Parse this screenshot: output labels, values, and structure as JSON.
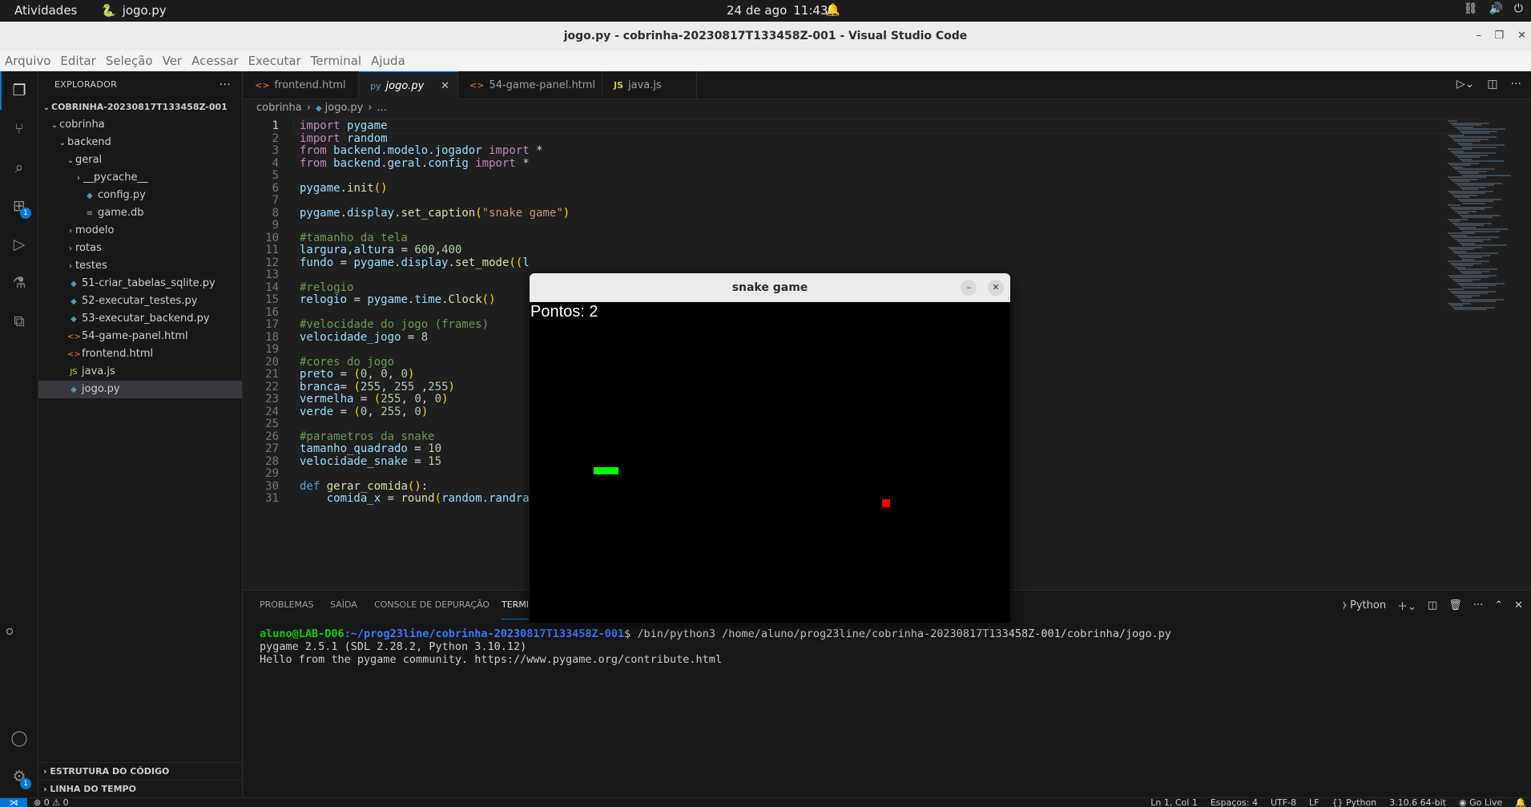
{
  "topbar": {
    "activities": "Atividades",
    "app_name": "jogo.py",
    "date": "24 de ago",
    "time": "11:43"
  },
  "window": {
    "title": "jogo.py - cobrinha-20230817T133458Z-001 - Visual Studio Code"
  },
  "menu": [
    "Arquivo",
    "Editar",
    "Seleção",
    "Ver",
    "Acessar",
    "Executar",
    "Terminal",
    "Ajuda"
  ],
  "activitybar": {
    "extensions_badge": "1",
    "settings_badge": "1"
  },
  "sidebar": {
    "title": "EXPLORADOR",
    "root": "COBRINHA-20230817T133458Z-001",
    "tree": [
      {
        "label": "cobrinha",
        "depth": 0,
        "kind": "folder-open"
      },
      {
        "label": "backend",
        "depth": 1,
        "kind": "folder-open"
      },
      {
        "label": "geral",
        "depth": 2,
        "kind": "folder-open"
      },
      {
        "label": "__pycache__",
        "depth": 3,
        "kind": "folder"
      },
      {
        "label": "config.py",
        "depth": 3,
        "kind": "py"
      },
      {
        "label": "game.db",
        "depth": 3,
        "kind": "db"
      },
      {
        "label": "modelo",
        "depth": 2,
        "kind": "folder"
      },
      {
        "label": "rotas",
        "depth": 2,
        "kind": "folder"
      },
      {
        "label": "testes",
        "depth": 2,
        "kind": "folder"
      },
      {
        "label": "51-criar_tabelas_sqlite.py",
        "depth": 1,
        "kind": "py"
      },
      {
        "label": "52-executar_testes.py",
        "depth": 1,
        "kind": "py"
      },
      {
        "label": "53-executar_backend.py",
        "depth": 1,
        "kind": "py"
      },
      {
        "label": "54-game-panel.html",
        "depth": 1,
        "kind": "html"
      },
      {
        "label": "frontend.html",
        "depth": 1,
        "kind": "html"
      },
      {
        "label": "java.js",
        "depth": 1,
        "kind": "js"
      },
      {
        "label": "jogo.py",
        "depth": 1,
        "kind": "py",
        "selected": true
      }
    ],
    "outline": "ESTRUTURA DO CÓDIGO",
    "timeline": "LINHA DO TEMPO"
  },
  "tabs": [
    {
      "label": "frontend.html",
      "icon": "<>"
    },
    {
      "label": "jogo.py",
      "icon": "py",
      "active": true
    },
    {
      "label": "54-game-panel.html",
      "icon": "<>"
    },
    {
      "label": "java.js",
      "icon": "JS"
    }
  ],
  "breadcrumb": {
    "folder": "cobrinha",
    "file": "jogo.py",
    "symbol": "..."
  },
  "code": [
    "import pygame",
    "import random",
    "from backend.modelo.jogador import *",
    "from backend.geral.config import *",
    "",
    "pygame.init()",
    "",
    "pygame.display.set_caption(\"snake game\")",
    "",
    "#tamanho da tela",
    "largura,altura = 600,400",
    "fundo = pygame.display.set_mode((l",
    "",
    "#relogio",
    "relogio = pygame.time.Clock()",
    "",
    "#velocidade do jogo (frames)",
    "velocidade_jogo = 8",
    "",
    "#cores do jogo",
    "preto = (0, 0, 0)",
    "branca= (255, 255 ,255)",
    "vermelha = (255, 0, 0)",
    "verde = (0, 255, 0)",
    "",
    "#parametros da snake",
    "tamanho_quadrado = 10",
    "velocidade_snake = 15",
    "",
    "def gerar_comida():",
    "    comida_x = round(random.randra"
  ],
  "panel": {
    "tabs": [
      "PROBLEMAS",
      "SAÍDA",
      "CONSOLE DE DEPURAÇÃO",
      "TERMI"
    ],
    "terminal_profile": "Python",
    "prompt_user": "aluno@LAB-D06",
    "prompt_path": ":~/prog23line/cobrinha-20230817T133458Z-001",
    "prompt_command": "$ /bin/python3 /home/aluno/prog23line/cobrinha-20230817T133458Z-001/cobrinha/jogo.py",
    "output": [
      "pygame 2.5.1 (SDL 2.28.2, Python 3.10.12)",
      "Hello from the pygame community. https://www.pygame.org/contribute.html"
    ]
  },
  "statusbar": {
    "problems": "⊗ 0 ⚠ 0",
    "position": "Ln 1, Col 1",
    "spaces": "Espaços: 4",
    "encoding": "UTF-8",
    "eol": "LF",
    "language": "Python",
    "interpreter": "3.10.6 64-bit",
    "golive": "Go Live"
  },
  "game": {
    "title": "snake game",
    "score_text": "Pontos: 2",
    "snake_color": "#00ff00",
    "food_color": "#ff0000",
    "background": "#000000"
  }
}
